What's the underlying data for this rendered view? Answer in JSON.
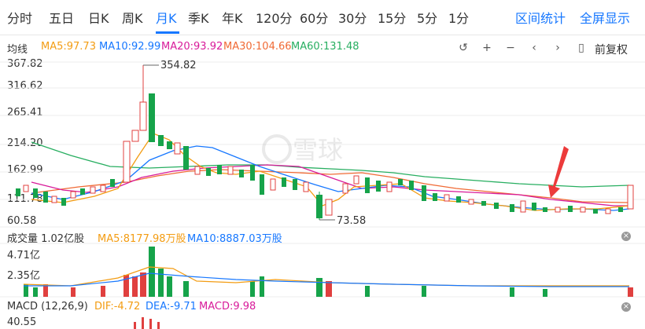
{
  "tabs": [
    "分时",
    "五日",
    "日K",
    "周K",
    "月K",
    "季K",
    "年K",
    "120分",
    "60分",
    "30分",
    "15分",
    "5分",
    "1分"
  ],
  "active_tab": "月K",
  "right_links": {
    "interval_stats": "区间统计",
    "fullscreen": "全屏显示"
  },
  "ma_legend": {
    "title": "均线",
    "ma5": "MA5:97.73",
    "ma10": "MA10:92.99",
    "ma20": "MA20:93.92",
    "ma30": "MA30:104.66",
    "ma60": "MA60:131.48"
  },
  "colors": {
    "ma5": "#f39c12",
    "ma10": "#1677ff",
    "ma20": "#d81b9a",
    "ma30": "#f06a35",
    "ma60": "#27ae60",
    "up": "#e0403f",
    "down": "#16a34a",
    "accent": "#1677ff"
  },
  "toolbar": {
    "restore_icon": "undo-icon",
    "zoom_in_icon": "plus-icon",
    "zoom_out_icon": "minus-icon",
    "prev_icon": "chevron-left-icon",
    "next_icon": "chevron-right-icon",
    "candle_icon": "candle-icon",
    "adjust_label": "前复权"
  },
  "price_axis": [
    "367.82",
    "316.62",
    "265.41",
    "214.20",
    "162.99",
    "111.78",
    "60.58"
  ],
  "annotations": {
    "high": "354.82",
    "low": "73.58"
  },
  "watermark": "雪球",
  "volume_legend": {
    "title": "成交量 1.02亿股",
    "ma5": "MA5:8177.98万股",
    "ma10": "MA10:8887.03万股"
  },
  "volume_axis": [
    "4.71亿",
    "2.35亿"
  ],
  "macd_legend": {
    "title": "MACD (12,26,9)",
    "dif": "DIF:-4.72",
    "dea": "DEA:-9.71",
    "macd": "MACD:9.98"
  },
  "macd_axis": [
    "40.55"
  ]
}
